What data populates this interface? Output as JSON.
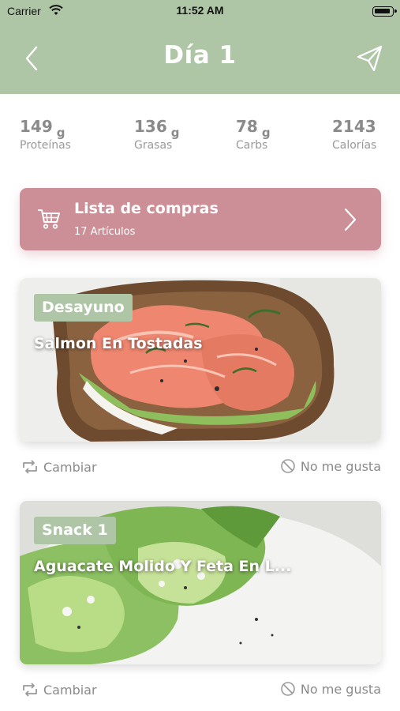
{
  "status_bar": {
    "carrier": "Carrier",
    "time": "11:52 AM"
  },
  "header": {
    "title": "Día 1"
  },
  "macros": [
    {
      "value": "149",
      "unit": "g",
      "label": "Proteínas"
    },
    {
      "value": "136",
      "unit": "g",
      "label": "Grasas"
    },
    {
      "value": "78",
      "unit": "g",
      "label": "Carbs"
    },
    {
      "value": "2143",
      "unit": "",
      "label": "Calorías"
    }
  ],
  "shopping_list": {
    "title": "Lista de compras",
    "count": "17 Artículos"
  },
  "meals": [
    {
      "tag": "Desayuno",
      "name": "Salmon En Tostadas",
      "swap_label": "Cambiar",
      "dislike_label": "No me gusta"
    },
    {
      "tag": "Snack 1",
      "name": "Aguacate Molido Y Feta En L...",
      "swap_label": "Cambiar",
      "dislike_label": "No me gusta"
    }
  ],
  "colors": {
    "header": "#afc6a6",
    "shopping_card": "#cc8f98",
    "tag": "#afc6a6",
    "muted_text": "#8a8a8a"
  },
  "icons": {
    "back": "chevron-left-icon",
    "send": "paper-plane-icon",
    "cart": "cart-icon",
    "swap": "swap-icon",
    "dislike": "block-icon"
  }
}
